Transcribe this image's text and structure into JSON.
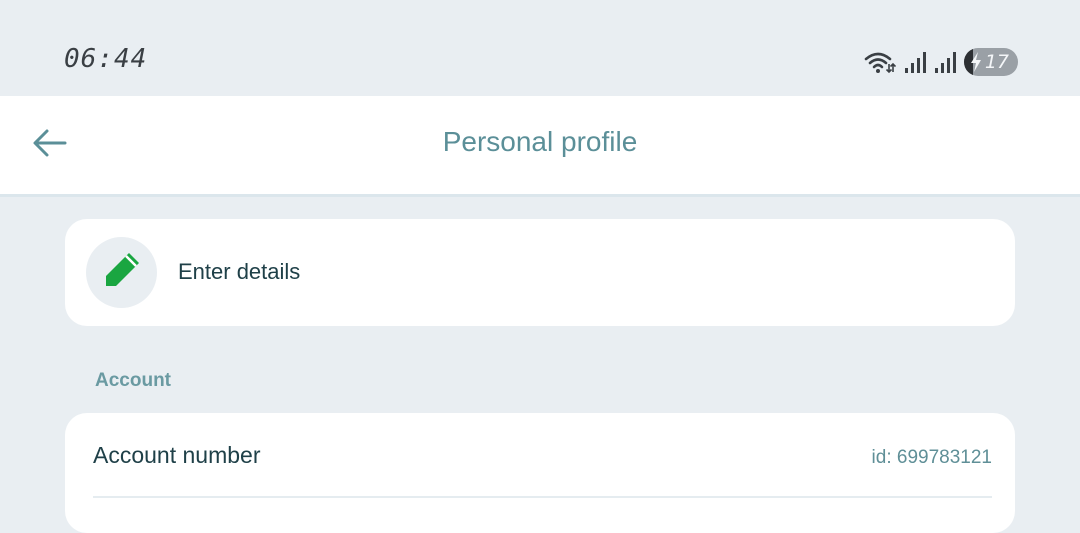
{
  "status_bar": {
    "time": "06:44",
    "battery_level": "17",
    "icons": [
      "wifi-icon",
      "signal-icon",
      "signal-icon",
      "battery-icon"
    ]
  },
  "header": {
    "back_icon": "arrow-left-icon",
    "title": "Personal profile"
  },
  "details_card": {
    "icon": "pencil-icon",
    "label": "Enter details"
  },
  "account_section": {
    "heading": "Account",
    "rows": [
      {
        "label": "Account number",
        "value": "id: 699783121"
      }
    ]
  },
  "colors": {
    "background": "#e9eef2",
    "accent_teal": "#5b8f98",
    "pencil_green": "#1aa641",
    "text_dark": "#1f4048"
  }
}
